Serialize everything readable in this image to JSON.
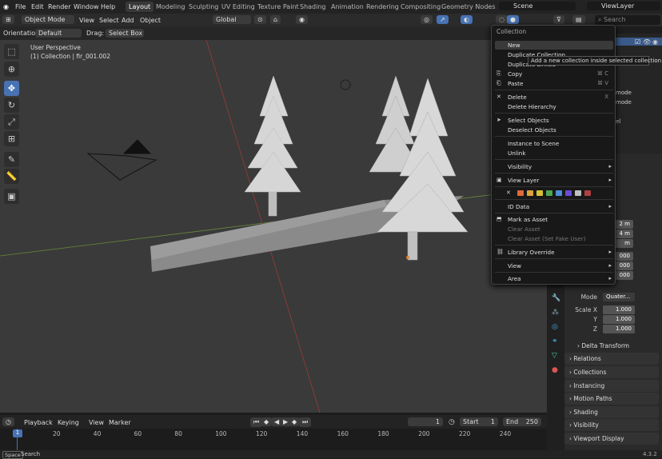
{
  "topbar": {
    "menus": [
      "File",
      "Edit",
      "Render",
      "Window",
      "Help"
    ],
    "workspaces": [
      "Layout",
      "Modeling",
      "Sculpting",
      "UV Editing",
      "Texture Paint",
      "Shading",
      "Animation",
      "Rendering",
      "Compositing",
      "Geometry Nodes"
    ],
    "scene": "Scene",
    "view_layer": "ViewLayer"
  },
  "header": {
    "mode": "Object Mode",
    "view": "View",
    "select": "Select",
    "add": "Add",
    "object": "Object",
    "orientation_label": "Global",
    "search_placeholder": "Search"
  },
  "header2": {
    "orientation": "Orientation:",
    "orientation_val": "Default",
    "drag": "Drag:",
    "drag_val": "Select Box"
  },
  "viewport": {
    "title": "User Perspective",
    "subtitle": "(1) Collection | fir_001.002"
  },
  "context_menu": {
    "title": "Collection",
    "tooltip": "Add a new collection inside selected collection.",
    "items": [
      {
        "label": "New",
        "shortcut": ""
      },
      {
        "label": "Duplicate Collection",
        "shortcut": ""
      },
      {
        "label": "Duplicate Linked",
        "shortcut": ""
      },
      {
        "label": "Copy",
        "shortcut": "⌘ C"
      },
      {
        "label": "Paste",
        "shortcut": "⌘ V"
      },
      {
        "label": "Delete",
        "shortcut": "X"
      },
      {
        "label": "Delete Hierarchy",
        "shortcut": ""
      },
      {
        "label": "Select Objects",
        "shortcut": ""
      },
      {
        "label": "Deselect Objects",
        "shortcut": ""
      },
      {
        "label": "Instance to Scene",
        "shortcut": ""
      },
      {
        "label": "Unlink",
        "shortcut": ""
      },
      {
        "label": "Visibility",
        "shortcut": ""
      },
      {
        "label": "View Layer",
        "shortcut": ""
      },
      {
        "label": "ID Data",
        "shortcut": ""
      },
      {
        "label": "Mark as Asset",
        "shortcut": ""
      },
      {
        "label": "Clear Asset",
        "shortcut": ""
      },
      {
        "label": "Clear Asset (Set Fake User)",
        "shortcut": ""
      },
      {
        "label": "Library Override",
        "shortcut": ""
      },
      {
        "label": "View",
        "shortcut": ""
      },
      {
        "label": "Area",
        "shortcut": ""
      }
    ],
    "swatch_colors": [
      "#e06a3a",
      "#e0a23a",
      "#d6c13a",
      "#4da64d",
      "#4d8fd6",
      "#6a4dd6",
      "#c0c0c0",
      "#b04040"
    ]
  },
  "outliner": {
    "rows": [
      "mode",
      "mode",
      "el"
    ]
  },
  "properties": {
    "loc_vals": [
      "2 m",
      "4 m",
      "m"
    ],
    "rot_vals": [
      "000",
      "000",
      "000"
    ],
    "mode_label": "Mode",
    "mode_val": "Quater...",
    "scale_x_label": "Scale X",
    "scale_y_label": "Y",
    "scale_z_label": "Z",
    "scale_x": "1.000",
    "scale_y": "1.000",
    "scale_z": "1.000",
    "sections": [
      "Delta Transform",
      "Relations",
      "Collections",
      "Instancing",
      "Motion Paths",
      "Shading",
      "Visibility",
      "Viewport Display"
    ]
  },
  "timeline": {
    "playback": "Playback",
    "keying": "Keying",
    "view": "View",
    "marker": "Marker",
    "current_frame": "1",
    "start_label": "Start",
    "start": "1",
    "end_label": "End",
    "end": "250",
    "ticks": [
      "1",
      "20",
      "40",
      "60",
      "80",
      "100",
      "120",
      "140",
      "160",
      "180",
      "200",
      "220",
      "240"
    ]
  },
  "statusbar": {
    "key": "Space",
    "label": "Search",
    "version": "4.3.2"
  }
}
